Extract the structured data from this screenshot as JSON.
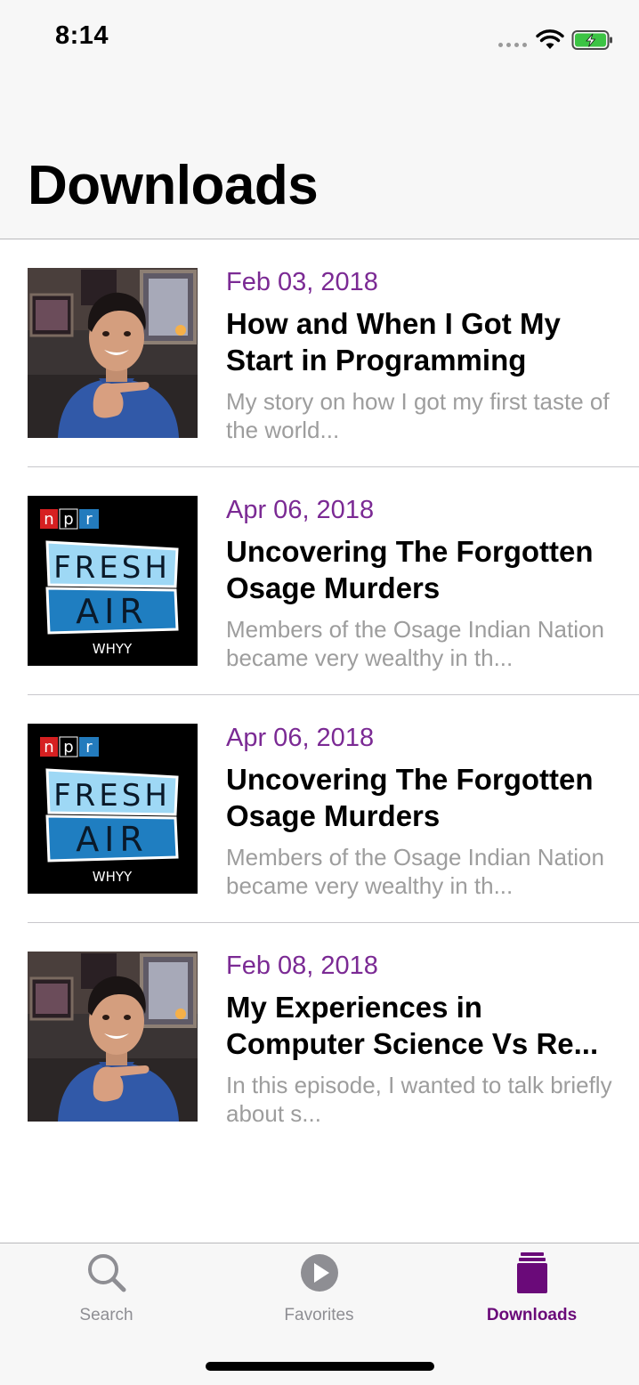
{
  "status_bar": {
    "time": "8:14"
  },
  "nav": {
    "title": "Downloads"
  },
  "episodes": [
    {
      "date": "Feb 03, 2018",
      "title": "How and When I Got My Start in Programming",
      "description": "My story on how I got my first taste of the world...",
      "artwork": "person-pointing-photo"
    },
    {
      "date": "Apr 06, 2018",
      "title": "Uncovering The Forgotten Osage Murders",
      "description": "Members of the Osage Indian Nation became very wealthy in th...",
      "artwork": "npr-fresh-air-logo"
    },
    {
      "date": "Apr 06, 2018",
      "title": "Uncovering The Forgotten Osage Murders",
      "description": "Members of the Osage Indian Nation became very wealthy in th...",
      "artwork": "npr-fresh-air-logo"
    },
    {
      "date": "Feb 08, 2018",
      "title": "My Experiences in Computer Science Vs Re...",
      "description": "In this episode, I wanted to talk briefly about s...",
      "artwork": "person-pointing-photo"
    }
  ],
  "artwork_text": {
    "npr": [
      "n",
      "p",
      "r"
    ],
    "fresh": "FRESH",
    "air": "AIR",
    "station": "WHYY"
  },
  "tab_bar": {
    "tabs": [
      {
        "label": "Search",
        "icon": "magnifier-icon",
        "active": false
      },
      {
        "label": "Favorites",
        "icon": "play-circle-icon",
        "active": false
      },
      {
        "label": "Downloads",
        "icon": "downloads-stack-icon",
        "active": true
      }
    ]
  },
  "colors": {
    "accent": "#6a0a79",
    "date": "#7b2a94",
    "secondary_text": "#9d9d9d",
    "tab_inactive": "#8e8e93",
    "bar_background": "#f7f7f7",
    "npr_red": "#d62021",
    "npr_black": "#000000",
    "npr_blue": "#237bbd",
    "fresh_light_blue": "#9ed8f5",
    "air_blue": "#1f7ec1"
  }
}
